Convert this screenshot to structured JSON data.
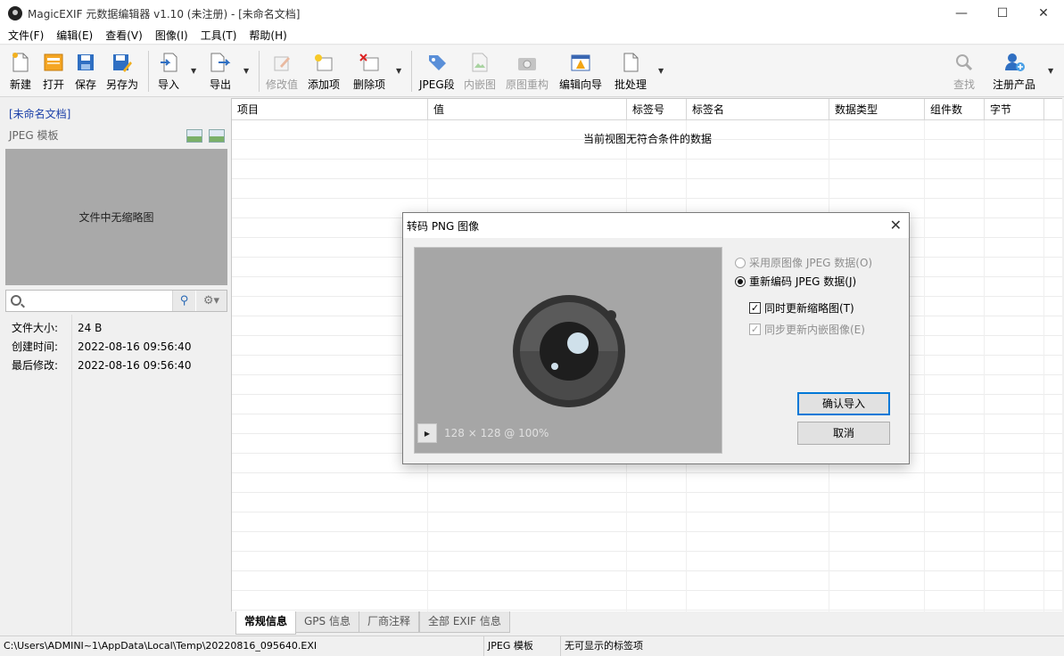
{
  "window": {
    "title": "MagicEXIF 元数据编辑器 v1.10 (未注册) - [未命名文档]",
    "controls": {
      "minimize": "—",
      "maximize": "☐",
      "close": "✕"
    }
  },
  "menu": [
    "文件(F)",
    "编辑(E)",
    "查看(V)",
    "图像(I)",
    "工具(T)",
    "帮助(H)"
  ],
  "toolbar": {
    "new": "新建",
    "open": "打开",
    "save": "保存",
    "save_as": "另存为",
    "import": "导入",
    "export": "导出",
    "edit_value": "修改值",
    "add_item": "添加项",
    "delete_item": "删除项",
    "jpeg_segment": "JPEG段",
    "embedded_image": "内嵌图",
    "rebuild_original": "原图重构",
    "edit_wizard": "编辑向导",
    "batch": "批处理",
    "find": "查找",
    "register": "注册产品"
  },
  "left_panel": {
    "doc_title": "[未命名文档]",
    "template_label": "JPEG 模板",
    "thumbnail_text": "文件中无缩略图",
    "search_placeholder": "",
    "info": [
      {
        "key": "文件大小:",
        "value": "24 B"
      },
      {
        "key": "创建时间:",
        "value": "2022-08-16 09:56:40"
      },
      {
        "key": "最后修改:",
        "value": "2022-08-16 09:56:40"
      }
    ]
  },
  "grid": {
    "columns": [
      "项目",
      "值",
      "标签号",
      "标签名",
      "数据类型",
      "组件数",
      "字节"
    ],
    "empty_message": "当前视图无符合条件的数据"
  },
  "tabs": [
    "常规信息",
    "GPS 信息",
    "厂商注释",
    "全部 EXIF 信息"
  ],
  "status": {
    "path": "C:\\Users\\ADMINI~1\\AppData\\Local\\Temp\\20220816_095640.EXI",
    "template": "JPEG 模板",
    "message": "无可显示的标签项"
  },
  "dialog": {
    "title": "转码 PNG 图像",
    "preview_dims": "128 × 128 @ 100%",
    "option_use_original": "采用原图像 JPEG 数据(O)",
    "option_reencode": "重新编码 JPEG 数据(J)",
    "check_update_thumb": "同时更新缩略图(T)",
    "check_sync_embedded": "同步更新内嵌图像(E)",
    "confirm": "确认导入",
    "cancel": "取消",
    "reencode_selected": true,
    "update_thumb_checked": true,
    "sync_embedded_checked": true
  }
}
